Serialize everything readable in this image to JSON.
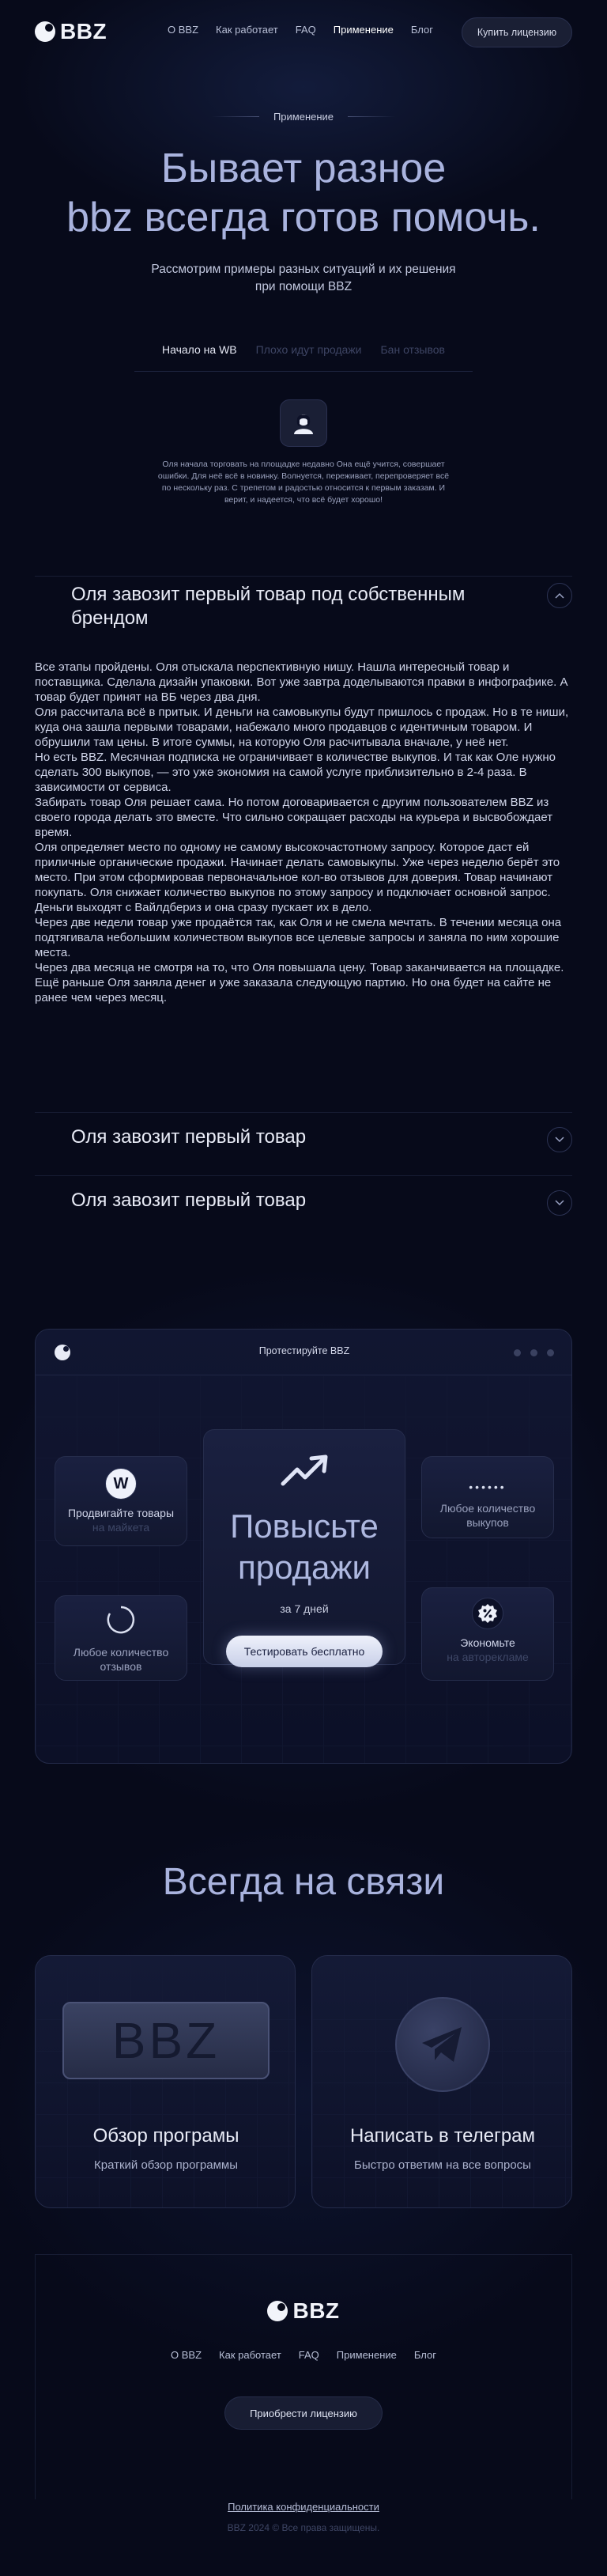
{
  "header": {
    "logo_text": "BBZ",
    "nav": [
      "О BBZ",
      "Как работает",
      "FAQ",
      "Применение",
      "Блог"
    ],
    "active_nav": "Применение",
    "buy_label": "Купить лицензию"
  },
  "hero": {
    "eyebrow": "Применение",
    "title_line1": "Бывает разное",
    "title_line2": "bbz всегда готов помочь.",
    "subtitle": "Рассмотрим примеры разных ситуаций и их решения при помощи BBZ"
  },
  "tabs": [
    {
      "label": "Начало на WB",
      "active": true
    },
    {
      "label": "Плохо идут продажи",
      "active": false
    },
    {
      "label": "Бан отзывов",
      "active": false
    }
  ],
  "story": {
    "avatar_icon": "user-avatar-icon",
    "intro": "Оля начала торговать на площадке недавно Она ещё учится, совершает ошибки. Для неё всё в новинку. Волнуется, переживает, перепроверяет всё по нескольку раз. С трепетом и радостью относится к первым заказам. И верит, и надеется, что всё будет хорошо!"
  },
  "accordions": [
    {
      "title": "Оля завозит первый товар под собственным брендом",
      "expanded": true,
      "icon": "chevron-up-icon",
      "paragraphs": [
        "Все этапы пройдены. Оля отыскала перспективную нишу. Нашла интересный товар и поставщика. Сделала дизайн упаковки. Вот уже завтра доделываются правки в инфографике. А товар будет принят на ВБ через два дня.",
        "Оля рассчитала всё в притык. И деньги на самовыкупы будут пришлось с продаж. Но в те ниши, куда она зашла первыми товарами, набежало много продавцов с идентичным товаром. И обрушили там цены. В итоге суммы, на которую Оля расчитывала вначале, у неё нет.",
        "Но есть BBZ. Месячная подписка не ограничивает в количестве выкупов. И так как Оле нужно сделать 300 выкупов, — это уже экономия на самой услуге приблизительно в 2-4 раза. В зависимости от сервиса.",
        "Забирать товар Оля решает сама. Но потом договаривается с другим пользователем BBZ из своего города делать это вместе. Что сильно сокращает расходы на курьера и высвобождает время.",
        "Оля определяет место по одному не самому высокочастотному запросу. Которое даст ей приличные органические продажи. Начинает делать самовыкупы. Уже через неделю берёт это место. При этом сформировав первоначальное кол-во отзывов для доверия. Товар начинают покупать. Оля снижает количество выкупов по этому запросу и подключает основной запрос. Деньги выходят с Вайлдбериз и она сразу пускает их в дело.",
        "Через две недели товар уже продаётся так, как Оля и не смела мечтать. В течении месяца она подтягивала небольшим количеством выкупов все целевые запросы и заняла по ним хорошие места.",
        "Через два месяца не смотря на то, что Оля повышала цену. Товар заканчивается на площадке. Ещё раньше Оля заняла денег и уже заказала следующую партию. Но она будет на сайте не ранее чем через месяц."
      ]
    },
    {
      "title": "Оля завозит первый товар",
      "expanded": false,
      "icon": "chevron-down-icon"
    },
    {
      "title": "Оля завозит первый товар",
      "expanded": false,
      "icon": "chevron-down-icon"
    }
  ],
  "panel": {
    "title": "Протестируйте BBZ",
    "main": {
      "title_line1": "Повысьте",
      "title_line2": "продажи",
      "sub": "за 7 дней",
      "button": "Тестировать бесплатно",
      "icon": "trending-up-icon"
    },
    "cards": [
      {
        "t": "Продвигайте товары",
        "s": "на майкета",
        "icon": "wildberries-icon"
      },
      {
        "t": "Любое количество",
        "s": "отзывов",
        "icon": "spinner-icon"
      },
      {
        "t": "Любое количество",
        "s": "выкупов",
        "icon": "dots-icon"
      },
      {
        "t": "Экономьте",
        "s": "на авторекламе",
        "icon": "percent-badge-icon"
      }
    ]
  },
  "contact": {
    "title": "Всегда на связи",
    "cards": [
      {
        "plate": "BBZ",
        "title": "Обзор програмы",
        "sub": "Краткий обзор программы"
      },
      {
        "title": "Написать в телеграм",
        "sub": "Быстро ответим на все вопросы",
        "icon": "telegram-icon"
      }
    ]
  },
  "footer": {
    "logo_text": "BBZ",
    "nav": [
      "О BBZ",
      "Как работает",
      "FAQ",
      "Применение",
      "Блог"
    ],
    "button": "Приобрести лицензию",
    "policy": "Политика конфиденциальности",
    "copyright": "BBZ 2024 © Все права защищены."
  }
}
